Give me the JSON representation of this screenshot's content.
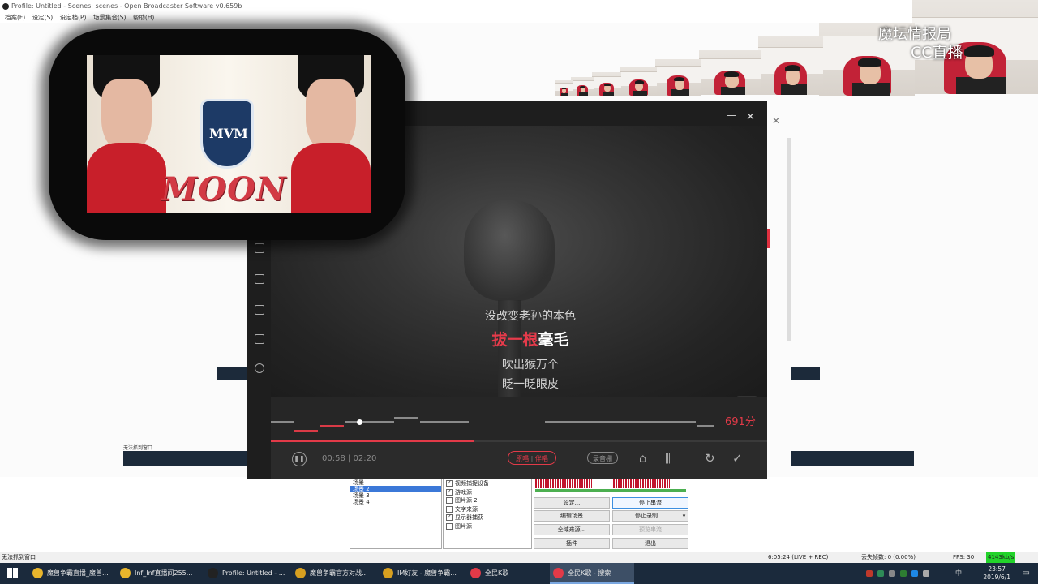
{
  "obs": {
    "title": "Profile: Untitled - Scenes: scenes - Open Broadcaster Software v0.659b",
    "menu": [
      "档案(F)",
      "设定(S)",
      "设定档(P)",
      "场景集合(S)",
      "帮助(H)"
    ],
    "scenes": [
      "场景",
      "场景 2",
      "场景 3",
      "场景 4"
    ],
    "selected_scene_index": 1,
    "sources": [
      {
        "label": "视频捕捉设备",
        "checked": true
      },
      {
        "label": "游戏源",
        "checked": true
      },
      {
        "label": "图片源 2",
        "checked": false
      },
      {
        "label": "文字来源",
        "checked": false
      },
      {
        "label": "显示器捕获",
        "checked": true
      },
      {
        "label": "图片源",
        "checked": false
      }
    ],
    "buttons": {
      "settings": "设定...",
      "stop_stream": "停止串流",
      "edit_scene": "编辑场景",
      "stop_record": "停止录制",
      "global_sources": "全域来源...",
      "preview_stream": "预览串流",
      "plugins": "插件",
      "exit": "退出"
    },
    "status_left": "无法抓到窗口",
    "status_time": "6:05:24 (LIVE + REC)",
    "status_dropped": "丢失帧数: 0 (0.00%)",
    "status_fps": "FPS: 30",
    "status_bitrate": "4143kb/s"
  },
  "watermark": {
    "line1": "魔坛情报局",
    "line2": "CC直播"
  },
  "banner": {
    "title": "MOON",
    "crest": "MVM"
  },
  "ktv": {
    "lyric_prev": "没改变老孙的本色",
    "lyric_current_sung": "拔一根",
    "lyric_current_rest": "毫毛",
    "lyric_next1": "吹出猴万个",
    "lyric_next2": "眨一眨眼皮",
    "score": "691分",
    "time": "00:58 | 02:20",
    "progress": 0.41,
    "mode_label": "原唱",
    "mode_sep": "|",
    "mode_alt": "伴唱",
    "record_label": "录音棚",
    "close_glyph": "✕",
    "minimize_glyph": "—"
  },
  "taskbar": {
    "items": [
      {
        "label": "魔兽争霸直播_魔兽...",
        "color": "#e8b52c"
      },
      {
        "label": "Inf_Inf直播间255...",
        "color": "#e8b52c"
      },
      {
        "label": "Profile: Untitled - ...",
        "color": "#222222"
      },
      {
        "label": "魔兽争霸官方对战...",
        "color": "#d8a020"
      },
      {
        "label": "IM好友 - 魔兽争霸...",
        "color": "#d8a020"
      },
      {
        "label": "全民K歌",
        "color": "#e23a48"
      },
      {
        "label": "全民K歌 - 搜索",
        "color": "#e23a48"
      }
    ],
    "active_index": 6,
    "clock_time": "23:57",
    "clock_date": "2019/6/1",
    "ime": "中"
  },
  "mini_taskbar": {
    "status": "无法抓到窗口"
  }
}
